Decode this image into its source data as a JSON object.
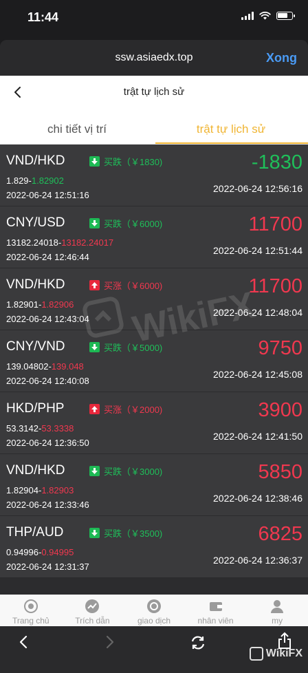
{
  "status": {
    "time": "11:44"
  },
  "browser": {
    "url": "ssw.asiaedx.top",
    "done_label": "Xong"
  },
  "header": {
    "title": "trật tự lịch sử"
  },
  "tabs": [
    {
      "label": "chi tiết vị trí",
      "active": false
    },
    {
      "label": "trật tự lịch sử",
      "active": true
    }
  ],
  "orders": [
    {
      "pair": "VND/HKD",
      "direction": "down",
      "dir_label": "买跌（￥1830)",
      "open_price": "1.829-",
      "close_price": "1.82902",
      "open_time": "2022-06-24 12:51:16",
      "pnl": "-1830",
      "close_time": "2022-06-24 12:56:16",
      "profit": false
    },
    {
      "pair": "CNY/USD",
      "direction": "down",
      "dir_label": "买跌（￥6000)",
      "open_price": "13182.24018-",
      "close_price": "13182.24017",
      "open_time": "2022-06-24 12:46:44",
      "pnl": "11700",
      "close_time": "2022-06-24 12:51:44",
      "profit": true
    },
    {
      "pair": "VND/HKD",
      "direction": "up",
      "dir_label": "买涨（￥6000)",
      "open_price": "1.82901-",
      "close_price": "1.82906",
      "open_time": "2022-06-24 12:43:04",
      "pnl": "11700",
      "close_time": "2022-06-24 12:48:04",
      "profit": true
    },
    {
      "pair": "CNY/VND",
      "direction": "down",
      "dir_label": "买跌（￥5000)",
      "open_price": "139.04802-",
      "close_price": "139.048",
      "open_time": "2022-06-24 12:40:08",
      "pnl": "9750",
      "close_time": "2022-06-24 12:45:08",
      "profit": true
    },
    {
      "pair": "HKD/PHP",
      "direction": "up",
      "dir_label": "买涨（￥2000)",
      "open_price": "53.3142-",
      "close_price": "53.3338",
      "open_time": "2022-06-24 12:36:50",
      "pnl": "3900",
      "close_time": "2022-06-24 12:41:50",
      "profit": true
    },
    {
      "pair": "VND/HKD",
      "direction": "down",
      "dir_label": "买跌（￥3000)",
      "open_price": "1.82904-",
      "close_price": "1.82903",
      "open_time": "2022-06-24 12:33:46",
      "pnl": "5850",
      "close_time": "2022-06-24 12:38:46",
      "profit": true
    },
    {
      "pair": "THP/AUD",
      "direction": "down",
      "dir_label": "买跌（￥3500)",
      "open_price": "0.94996-",
      "close_price": "0.94995",
      "open_time": "2022-06-24 12:31:37",
      "pnl": "6825",
      "close_time": "2022-06-24 12:36:37",
      "profit": true
    }
  ],
  "watermark": {
    "text": "WikiFX"
  },
  "tabbar": [
    {
      "label": "Trang chủ",
      "icon": "home-icon"
    },
    {
      "label": "Trích dẫn",
      "icon": "quote-chart-icon"
    },
    {
      "label": "giao dịch",
      "icon": "trade-icon"
    },
    {
      "label": "nhân viên",
      "icon": "wallet-icon"
    },
    {
      "label": "my",
      "icon": "user-icon"
    }
  ],
  "corner_logo": {
    "text": "WikiFX"
  },
  "colors": {
    "profit": "#f0384f",
    "loss": "#1fbf5a",
    "accent": "#f0b533",
    "link": "#4a9bf5"
  }
}
